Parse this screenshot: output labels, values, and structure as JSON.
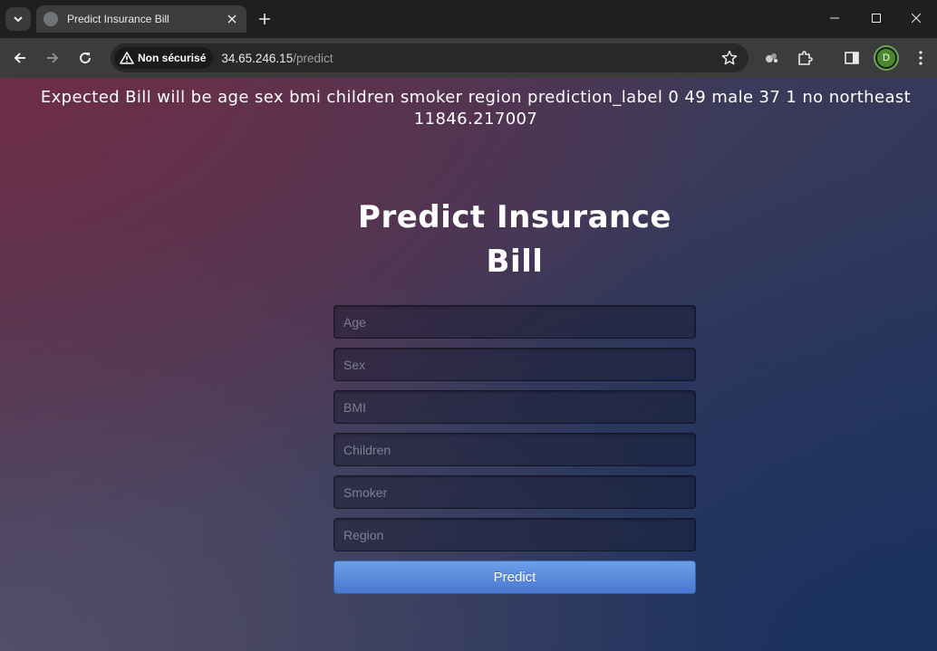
{
  "browser": {
    "tab_title": "Predict Insurance Bill",
    "security_label": "Non sécurisé",
    "url_host": "34.65.246.15",
    "url_path": "/predict",
    "profile_initial": "D"
  },
  "page": {
    "result_text": "Expected Bill will be age sex bmi children smoker region prediction_label 0 49 male 37 1 no northeast 11846.217007",
    "title": "Predict Insurance Bill",
    "fields": {
      "age_placeholder": "Age",
      "sex_placeholder": "Sex",
      "bmi_placeholder": "BMI",
      "children_placeholder": "Children",
      "smoker_placeholder": "Smoker",
      "region_placeholder": "Region"
    },
    "predict_label": "Predict"
  },
  "icons": [
    "chevron-down-icon",
    "globe-icon",
    "close-icon",
    "plus-icon",
    "minimize-icon",
    "maximize-icon",
    "window-close-icon",
    "back-arrow-icon",
    "forward-arrow-icon",
    "reload-icon",
    "warning-icon",
    "star-icon",
    "extension-icon",
    "puzzle-icon",
    "sidebar-icon",
    "more-icon"
  ]
}
